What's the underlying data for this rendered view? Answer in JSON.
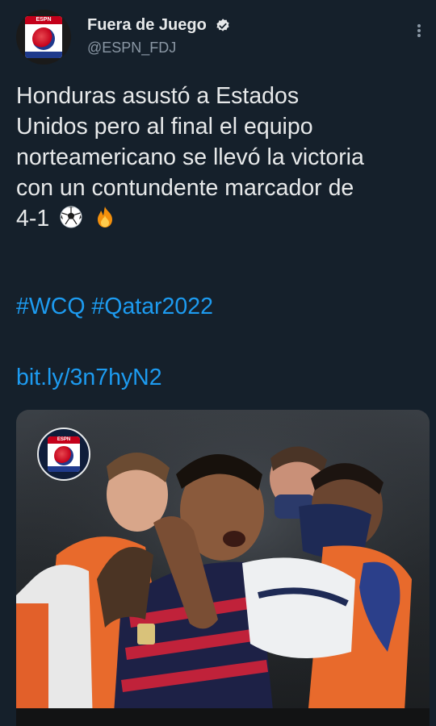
{
  "author": {
    "display_name": "Fuera de Juego",
    "handle": "@ESPN_FDJ",
    "verified": true,
    "avatar_icon": "espn-fdj-logo-icon",
    "avatar_text": "ESPN"
  },
  "tweet": {
    "lines": [
      "Honduras asustó a Estados",
      "Unidos pero al final el equipo",
      "norteamericano se llevó la victoria",
      "con un contundente marcador de",
      "4-1"
    ],
    "emojis": [
      "soccer-ball-icon",
      "fire-icon"
    ],
    "hashtags": [
      "#WCQ",
      "#Qatar2022"
    ],
    "link": "bit.ly/3n7hyN2"
  },
  "media": {
    "description_icon": "match-photo",
    "overlay_logo_text": "ESPN"
  },
  "colors": {
    "background": "#15202b",
    "text": "#e7e9ea",
    "secondary": "#8b98a5",
    "link": "#1d9bf0"
  }
}
